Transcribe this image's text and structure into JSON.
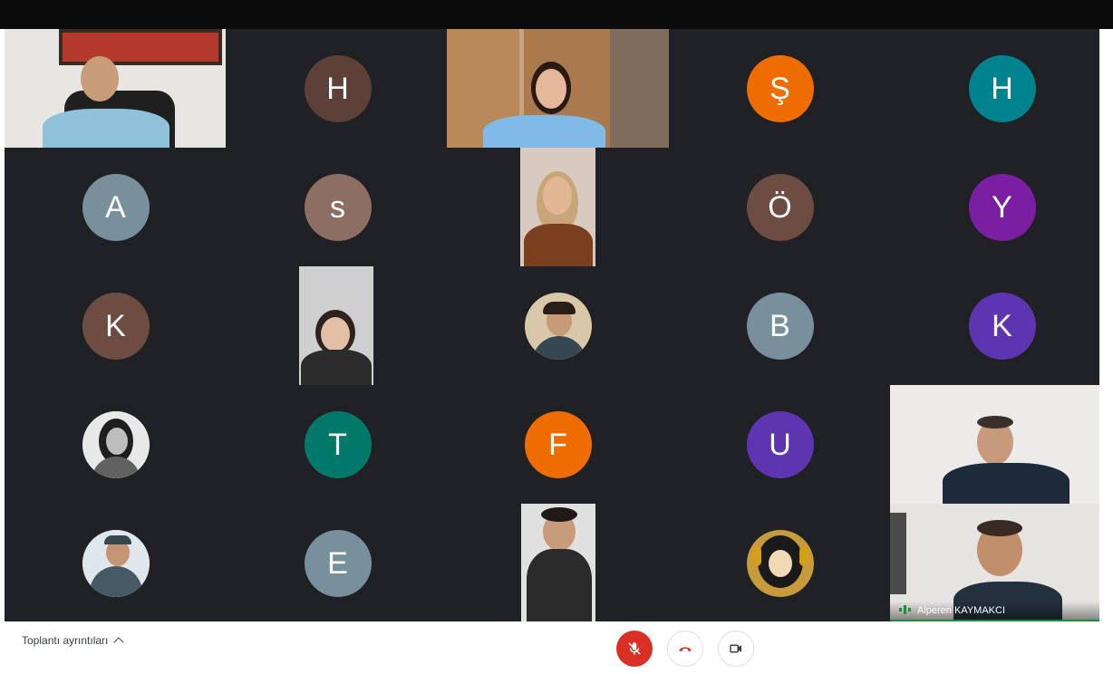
{
  "participants": [
    {
      "id": "p1",
      "kind": "video",
      "bg": "#e8e6e3"
    },
    {
      "id": "p2",
      "kind": "letter",
      "letter": "H",
      "color": "#5d4037"
    },
    {
      "id": "p3",
      "kind": "video",
      "bg": "#c9a27a"
    },
    {
      "id": "p4",
      "kind": "letter",
      "letter": "Ş",
      "color": "#ef6c00"
    },
    {
      "id": "p5",
      "kind": "letter",
      "letter": "H",
      "color": "#00838f"
    },
    {
      "id": "p6",
      "kind": "letter",
      "letter": "A",
      "color": "#78909c"
    },
    {
      "id": "p7",
      "kind": "letter",
      "letter": "s",
      "color": "#8d6e63"
    },
    {
      "id": "p8",
      "kind": "video",
      "bg": "#d7cbbf"
    },
    {
      "id": "p9",
      "kind": "letter",
      "letter": "Ö",
      "color": "#6d4c41"
    },
    {
      "id": "p10",
      "kind": "letter",
      "letter": "Y",
      "color": "#7b1fa2"
    },
    {
      "id": "p11",
      "kind": "letter",
      "letter": "K",
      "color": "#6d4c41"
    },
    {
      "id": "p12",
      "kind": "video",
      "bg": "#cfcfcf"
    },
    {
      "id": "p13",
      "kind": "photo",
      "bg": "#d8c7a8"
    },
    {
      "id": "p14",
      "kind": "letter",
      "letter": "B",
      "color": "#78909c"
    },
    {
      "id": "p15",
      "kind": "letter",
      "letter": "K",
      "color": "#5e35b1"
    },
    {
      "id": "p16",
      "kind": "photo",
      "bg": "#9e9e9e"
    },
    {
      "id": "p17",
      "kind": "letter",
      "letter": "T",
      "color": "#00796b"
    },
    {
      "id": "p18",
      "kind": "letter",
      "letter": "F",
      "color": "#ef6c00"
    },
    {
      "id": "p19",
      "kind": "letter",
      "letter": "U",
      "color": "#5e35b1"
    },
    {
      "id": "p20",
      "kind": "video",
      "bg": "#ecebea"
    },
    {
      "id": "p21",
      "kind": "photo",
      "bg": "#b0bec5"
    },
    {
      "id": "p22",
      "kind": "letter",
      "letter": "E",
      "color": "#78909c"
    },
    {
      "id": "p23",
      "kind": "video",
      "bg": "#e0e0e0"
    },
    {
      "id": "p24",
      "kind": "photo",
      "bg": "#4e342e"
    },
    {
      "id": "p25",
      "kind": "video",
      "bg": "#e6e4e1"
    }
  ],
  "speaker_name": "Alperen KAYMAKCI",
  "bottom": {
    "meeting_details_label": "Toplantı ayrıntıları",
    "mic_color": "#d93025",
    "hangup_color": "#d93025"
  }
}
